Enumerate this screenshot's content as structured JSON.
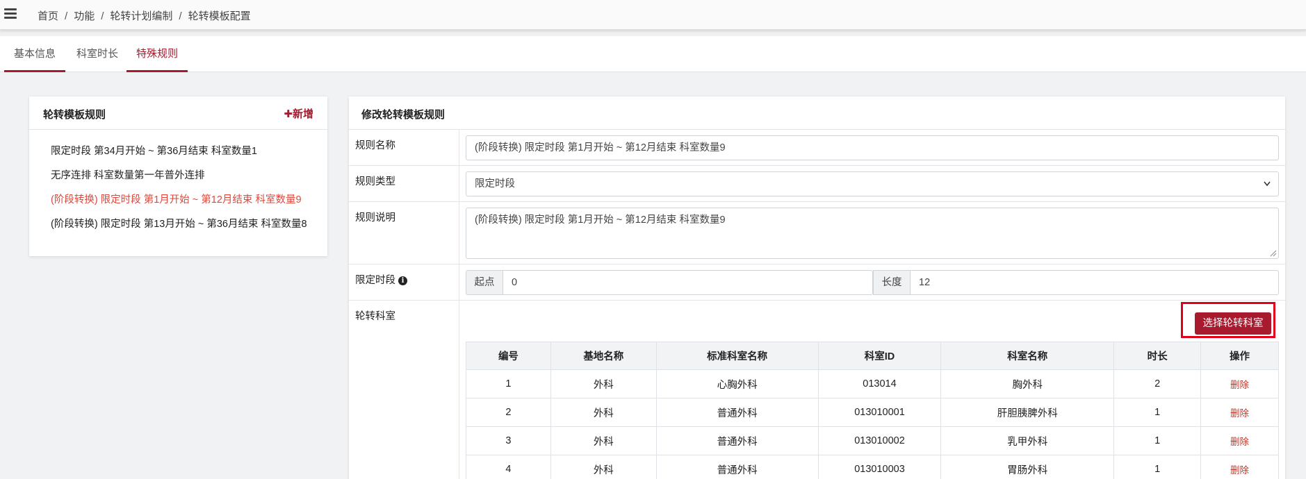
{
  "breadcrumb": [
    "首页",
    "功能",
    "轮转计划编制",
    "轮转模板配置"
  ],
  "tabs": [
    {
      "label": "基本信息"
    },
    {
      "label": "科室时长"
    },
    {
      "label": "特殊规则"
    }
  ],
  "active_tab": "特殊规则",
  "left_panel": {
    "title": "轮转模板规则",
    "add_label": "新增",
    "rules": [
      "限定时段 第34月开始 ~ 第36月结束 科室数量1",
      "无序连排 科室数量第一年普外连排",
      "(阶段转换) 限定时段 第1月开始 ~ 第12月结束 科室数量9",
      "(阶段转换) 限定时段 第13月开始 ~ 第36月结束 科室数量8"
    ]
  },
  "right_panel": {
    "title": "修改轮转模板规则",
    "fields": {
      "name_label": "规则名称",
      "name_value": "(阶段转换) 限定时段 第1月开始 ~ 第12月结束 科室数量9",
      "type_label": "规则类型",
      "type_value": "限定时段",
      "desc_label": "规则说明",
      "desc_value": "(阶段转换) 限定时段 第1月开始 ~ 第12月结束 科室数量9",
      "period_label": "限定时段",
      "start_addon": "起点",
      "start_value": "0",
      "length_addon": "长度",
      "length_value": "12",
      "dept_label": "轮转科室"
    },
    "select_dept_button": "选择轮转科室",
    "table": {
      "headers": [
        "编号",
        "基地名称",
        "标准科室名称",
        "科室ID",
        "科室名称",
        "时长",
        "操作"
      ],
      "rows": [
        {
          "no": "1",
          "base": "外科",
          "std": "心胸外科",
          "id": "013014",
          "name": "胸外科",
          "dur": "2",
          "op": "删除"
        },
        {
          "no": "2",
          "base": "外科",
          "std": "普通外科",
          "id": "013010001",
          "name": "肝胆胰脾外科",
          "dur": "1",
          "op": "删除"
        },
        {
          "no": "3",
          "base": "外科",
          "std": "普通外科",
          "id": "013010002",
          "name": "乳甲外科",
          "dur": "1",
          "op": "删除"
        },
        {
          "no": "4",
          "base": "外科",
          "std": "普通外科",
          "id": "013010003",
          "name": "胃肠外科",
          "dur": "1",
          "op": "删除"
        }
      ]
    }
  },
  "colors": {
    "accent": "#a81b2e",
    "active_rule": "#e0463a",
    "highlight_box": "#e0001a"
  }
}
